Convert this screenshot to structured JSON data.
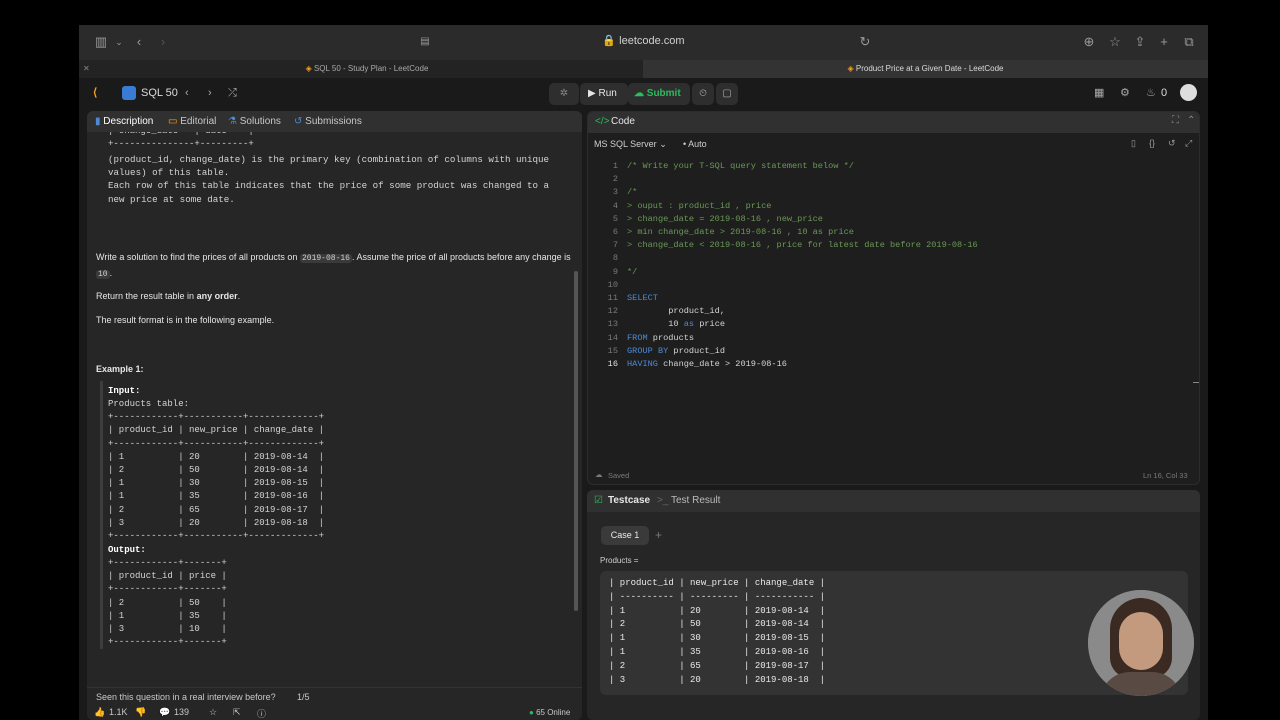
{
  "browser": {
    "url": "leetcode.com",
    "tabs": [
      {
        "title": "SQL 50 - Study Plan - LeetCode",
        "active": false
      },
      {
        "title": "Product Price at a Given Date - LeetCode",
        "active": true
      }
    ]
  },
  "nav": {
    "study_plan": "SQL 50",
    "run_label": "Run",
    "submit_label": "Submit",
    "streak_count": "0"
  },
  "left": {
    "tabs": [
      "Description",
      "Editorial",
      "Solutions",
      "Submissions"
    ],
    "schema_top": "| change_date   | date    |\n+---------------+---------+",
    "schema_note": "(product_id, change_date) is the primary key (combination of columns with unique\nvalues) of this table.\nEach row of this table indicates that the price of some product was changed to a\nnew price at some date.",
    "q_part1": "Write a solution to find the prices of all products on",
    "q_date": "2019-08-16",
    "q_part2": ". Assume the price of all products before any",
    "q_part3": "change is",
    "q_ten": "10",
    "q_part4": ".",
    "return_prefix": "Return the result table in",
    "return_bold": "any order",
    "return_suffix": ".",
    "format_text": "The result format is in the following example.",
    "example_title": "Example 1:",
    "input_label": "Input:",
    "input_block": "Products table:\n+------------+-----------+-------------+\n| product_id | new_price | change_date |\n+------------+-----------+-------------+\n| 1          | 20        | 2019-08-14  |\n| 2          | 50        | 2019-08-14  |\n| 1          | 30        | 2019-08-15  |\n| 1          | 35        | 2019-08-16  |\n| 2          | 65        | 2019-08-17  |\n| 3          | 20        | 2019-08-18  |\n+------------+-----------+-------------+",
    "output_label": "Output:",
    "output_block": "+------------+-------+\n| product_id | price |\n+------------+-------+\n| 2          | 50    |\n| 1          | 35    |\n| 3          | 10    |\n+------------+-------+",
    "interview_q": "Seen this question in a real interview before?",
    "interview_page": "1/5",
    "likes": "1.1K",
    "comments": "139",
    "online": "65 Online"
  },
  "code": {
    "header": "Code",
    "language": "MS SQL Server",
    "mode": "Auto",
    "status": "Saved",
    "cursor": "Ln 16, Col 33",
    "lines": [
      {
        "n": "1",
        "t": "/* Write your T-SQL query statement below */",
        "k": "c-com"
      },
      {
        "n": "2",
        "t": "",
        "k": "c-pl"
      },
      {
        "n": "3",
        "t": "/*",
        "k": "c-com"
      },
      {
        "n": "4",
        "t": "> ouput : product_id , price",
        "k": "c-com"
      },
      {
        "n": "5",
        "t": "> change_date = 2019-08-16 , new_price",
        "k": "c-com"
      },
      {
        "n": "6",
        "t": "> min change_date > 2019-08-16 , 10 as price",
        "k": "c-com"
      },
      {
        "n": "7",
        "t": "> change_date < 2019-08-16 , price for latest date before 2019-08-16",
        "k": "c-com"
      },
      {
        "n": "8",
        "t": "",
        "k": "c-pl"
      },
      {
        "n": "9",
        "t": "*/",
        "k": "c-com"
      },
      {
        "n": "10",
        "t": "",
        "k": "c-pl"
      },
      {
        "n": "11",
        "t": "SELECT",
        "k": "c-kw"
      },
      {
        "n": "12",
        "t": "        product_id,",
        "k": "c-pl"
      },
      {
        "n": "13",
        "t": "        10 as price",
        "k": "c-pl"
      },
      {
        "n": "14",
        "t": "FROM products",
        "k": "c-pl"
      },
      {
        "n": "15",
        "t": "GROUP BY product_id",
        "k": "c-pl"
      },
      {
        "n": "16",
        "t": "HAVING change_date > 2019-08-16",
        "k": "c-pl"
      }
    ]
  },
  "testcase": {
    "tab_testcase": "Testcase",
    "tab_result": "Test Result",
    "case_label": "Case 1",
    "table_label": "Products =",
    "table_block": "| product_id | new_price | change_date |\n| ---------- | --------- | ----------- |\n| 1          | 20        | 2019-08-14  |\n| 2          | 50        | 2019-08-14  |\n| 1          | 30        | 2019-08-15  |\n| 1          | 35        | 2019-08-16  |\n| 2          | 65        | 2019-08-17  |\n| 3          | 20        | 2019-08-18  |"
  },
  "colors": {
    "submit_green": "#2cbb5d",
    "accent_orange": "#ffa116",
    "keyword_blue": "#4c8ad6",
    "comment_green": "#6a9955"
  }
}
